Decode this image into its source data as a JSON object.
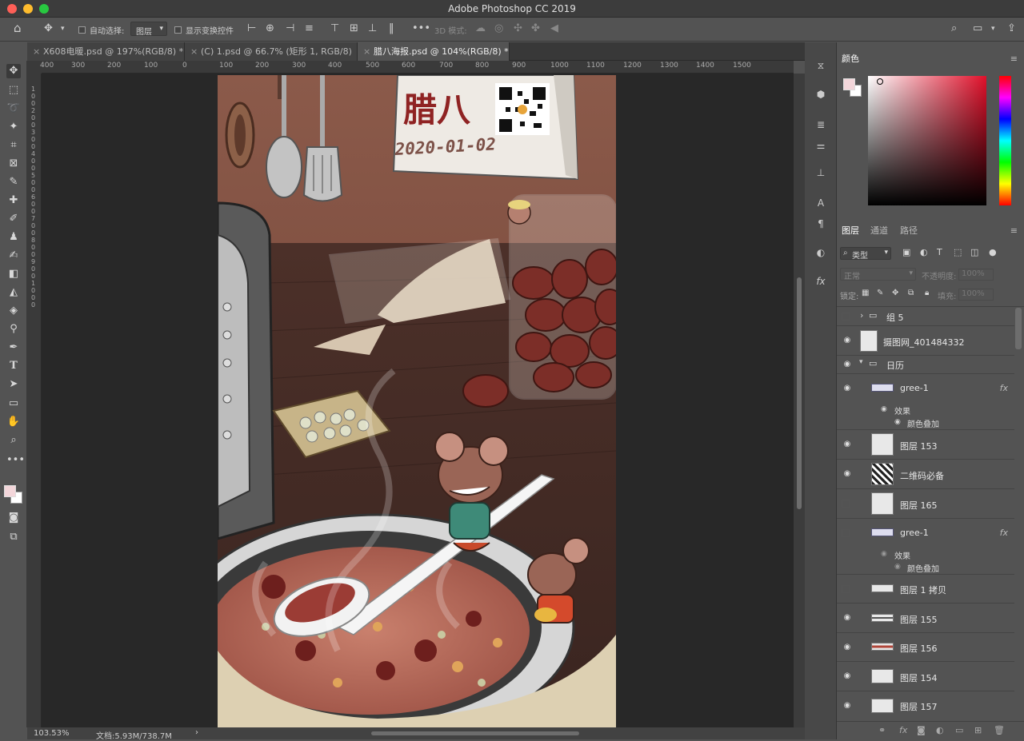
{
  "app_title": "Adobe Photoshop CC 2019",
  "options_bar": {
    "auto_select_label": "自动选择:",
    "auto_select_value": "图层",
    "show_transform_label": "显示变换控件",
    "mode_3d_label": "3D 模式:"
  },
  "tabs": [
    {
      "label": "X608电暖.psd @ 197%(RGB/8) *"
    },
    {
      "label": "(C) 1.psd @ 66.7% (矩形 1, RGB/8) *"
    },
    {
      "label": "腊八海报.psd @ 104%(RGB/8) *"
    }
  ],
  "ruler_h": [
    "400",
    "300",
    "200",
    "100",
    "0",
    "100",
    "200",
    "300",
    "400",
    "500",
    "600",
    "700",
    "800",
    "900",
    "1000",
    "1100",
    "1200",
    "1300",
    "1400",
    "1500"
  ],
  "ruler_v": [
    "1",
    "0",
    "0",
    "2",
    "0",
    "0",
    "3",
    "0",
    "0",
    "4",
    "0",
    "0",
    "5",
    "0",
    "0",
    "6",
    "0",
    "0",
    "7",
    "0",
    "0",
    "8",
    "0",
    "0",
    "9",
    "0",
    "0",
    "1",
    "0",
    "0",
    "0"
  ],
  "artwork": {
    "calendar_title": "腊八",
    "calendar_date": "2020-01-02"
  },
  "status": {
    "zoom": "103.53%",
    "doc": "文档:5.93M/738.7M"
  },
  "color_panel": {
    "title": "颜色"
  },
  "layers_panel": {
    "tabs": [
      "图层",
      "通道",
      "路径"
    ],
    "filter_kind": "类型",
    "blend_mode": "正常",
    "opacity_label": "不透明度:",
    "opacity_value": "100%",
    "lock_label": "锁定:",
    "fill_label": "填充:",
    "fill_value": "100%",
    "layers": [
      {
        "name": "组 5",
        "visible": false,
        "type": "group"
      },
      {
        "name": "摄图网_401484332",
        "visible": true,
        "type": "smart"
      },
      {
        "name": "日历",
        "visible": true,
        "type": "group"
      },
      {
        "name": "gree-1",
        "visible": true,
        "type": "layer",
        "fx": "fx"
      },
      {
        "name": "图层 153",
        "visible": true,
        "type": "layer"
      },
      {
        "name": "二维码必备",
        "visible": true,
        "type": "smart"
      },
      {
        "name": "图层 165",
        "visible": false,
        "type": "layer"
      },
      {
        "name": "gree-1",
        "visible": false,
        "type": "layer",
        "fx": "fx"
      },
      {
        "name": "图层 1 拷贝",
        "visible": false,
        "type": "layer"
      },
      {
        "name": "图层 155",
        "visible": true,
        "type": "layer"
      },
      {
        "name": "图层 156",
        "visible": true,
        "type": "layer"
      },
      {
        "name": "图层 154",
        "visible": true,
        "type": "layer"
      },
      {
        "name": "图层 157",
        "visible": true,
        "type": "layer"
      }
    ],
    "effects_label": "效果",
    "color_overlay_label": "颜色叠加"
  }
}
